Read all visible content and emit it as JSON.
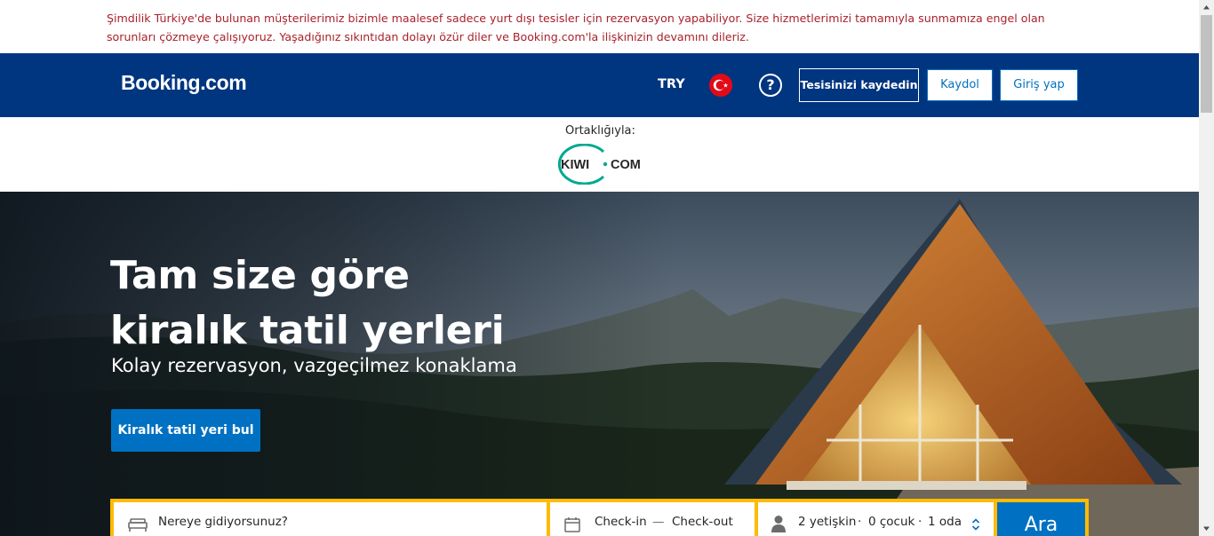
{
  "notice": {
    "text": "Şimdilik Türkiye'de bulunan müşterilerimiz bizimle maalesef sadece yurt dışı tesisler için rezervasyon yapabiliyor. Size hizmetlerimizi tamamıyla sunmamıza engel olan sorunları çözmeye çalışıyoruz. Yaşadığınız sıkıntıdan dolayı özür diler ve Booking.com'la ilişkinizin devamını dileriz.",
    "color": "#a8222b"
  },
  "header": {
    "logo": "Booking.com",
    "currency": "TRY",
    "flag_icon": "turkey-flag-icon",
    "help_icon": "question-circle-icon",
    "help_glyph": "?",
    "list_property": "Tesisinizi kaydedin",
    "register": "Kaydol",
    "sign_in": "Giriş yap",
    "bg_color": "#003580"
  },
  "partner": {
    "label": "Ortaklığıyla:",
    "logo_kiwi": "KIWI",
    "logo_com": "COM",
    "accent": "#00a991"
  },
  "hero": {
    "title_line1": "Tam size göre",
    "title_line2": "kiralık tatil yerleri",
    "subtitle": "Kolay rezervasyon, vazgeçilmez konaklama",
    "cta": "Kiralık tatil yeri bul"
  },
  "search": {
    "destination_placeholder": "Nereye gidiyorsunuz?",
    "checkin": "Check-in",
    "dash": "—",
    "checkout": "Check-out",
    "adults": "2 yetişkin",
    "sep1": "·",
    "children": "0 çocuk",
    "sep2": "·",
    "rooms": "1 oda",
    "button": "Ara",
    "bed_icon": "bed-icon",
    "calendar_icon": "calendar-icon",
    "person_icon": "person-icon",
    "stepper_icon": "up-down-chevron-icon",
    "accent": "#febb02",
    "button_color": "#0071c2"
  }
}
